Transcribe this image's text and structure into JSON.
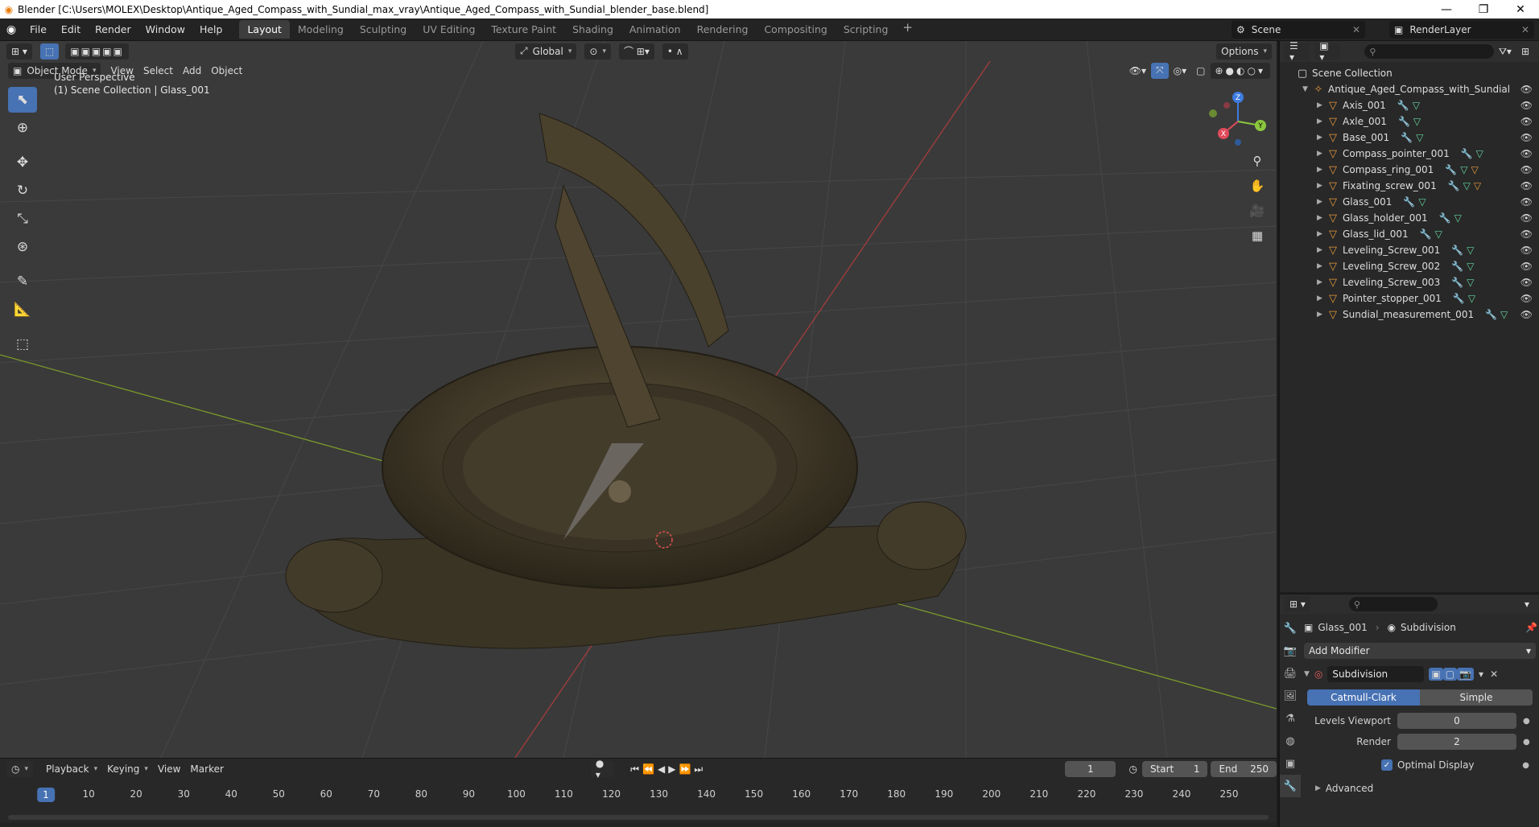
{
  "window": {
    "title": "Blender [C:\\Users\\MOLEX\\Desktop\\Antique_Aged_Compass_with_Sundial_max_vray\\Antique_Aged_Compass_with_Sundial_blender_base.blend]",
    "minimize": "—",
    "maximize": "❐",
    "close": "✕"
  },
  "menu": [
    "File",
    "Edit",
    "Render",
    "Window",
    "Help"
  ],
  "workspaces": [
    "Layout",
    "Modeling",
    "Sculpting",
    "UV Editing",
    "Texture Paint",
    "Shading",
    "Animation",
    "Rendering",
    "Compositing",
    "Scripting"
  ],
  "active_workspace": "Layout",
  "scene": {
    "name": "Scene",
    "render_layer": "RenderLayer"
  },
  "viewport": {
    "mode": "Object Mode",
    "menus": [
      "View",
      "Select",
      "Add",
      "Object"
    ],
    "transform_orientation": "Global",
    "options_label": "Options",
    "overlay_title": "User Perspective",
    "overlay_subtitle": "(1) Scene Collection | Glass_001",
    "gizmo": {
      "x": "X",
      "y": "Y",
      "z": "Z"
    }
  },
  "timeline": {
    "menus": [
      "Playback",
      "Keying",
      "View",
      "Marker"
    ],
    "current_frame": "1",
    "start_label": "Start",
    "start": "1",
    "end_label": "End",
    "end": "250",
    "ruler": [
      "1",
      "10",
      "20",
      "30",
      "40",
      "50",
      "60",
      "70",
      "80",
      "90",
      "100",
      "110",
      "120",
      "130",
      "140",
      "150",
      "160",
      "170",
      "180",
      "190",
      "200",
      "210",
      "220",
      "230",
      "240",
      "250"
    ]
  },
  "outliner": {
    "root": "Scene Collection",
    "collection": "Antique_Aged_Compass_with_Sundial",
    "objects": [
      {
        "name": "Axis_001",
        "extra": false
      },
      {
        "name": "Axle_001",
        "extra": false
      },
      {
        "name": "Base_001",
        "extra": false
      },
      {
        "name": "Compass_pointer_001",
        "extra": false
      },
      {
        "name": "Compass_ring_001",
        "extra": true
      },
      {
        "name": "Fixating_screw_001",
        "extra": true
      },
      {
        "name": "Glass_001",
        "extra": false
      },
      {
        "name": "Glass_holder_001",
        "extra": false
      },
      {
        "name": "Glass_lid_001",
        "extra": false
      },
      {
        "name": "Leveling_Screw_001",
        "extra": false
      },
      {
        "name": "Leveling_Screw_002",
        "extra": false
      },
      {
        "name": "Leveling_Screw_003",
        "extra": false
      },
      {
        "name": "Pointer_stopper_001",
        "extra": false
      },
      {
        "name": "Sundial_measurement_001",
        "extra": false
      }
    ]
  },
  "properties": {
    "object": "Glass_001",
    "modifier_context": "Subdivision",
    "add_modifier": "Add Modifier",
    "modifier_name": "Subdivision",
    "method_a": "Catmull-Clark",
    "method_b": "Simple",
    "levels_viewport_label": "Levels Viewport",
    "levels_viewport": "0",
    "render_label": "Render",
    "render": "2",
    "optimal_display": "Optimal Display",
    "advanced": "Advanced"
  }
}
